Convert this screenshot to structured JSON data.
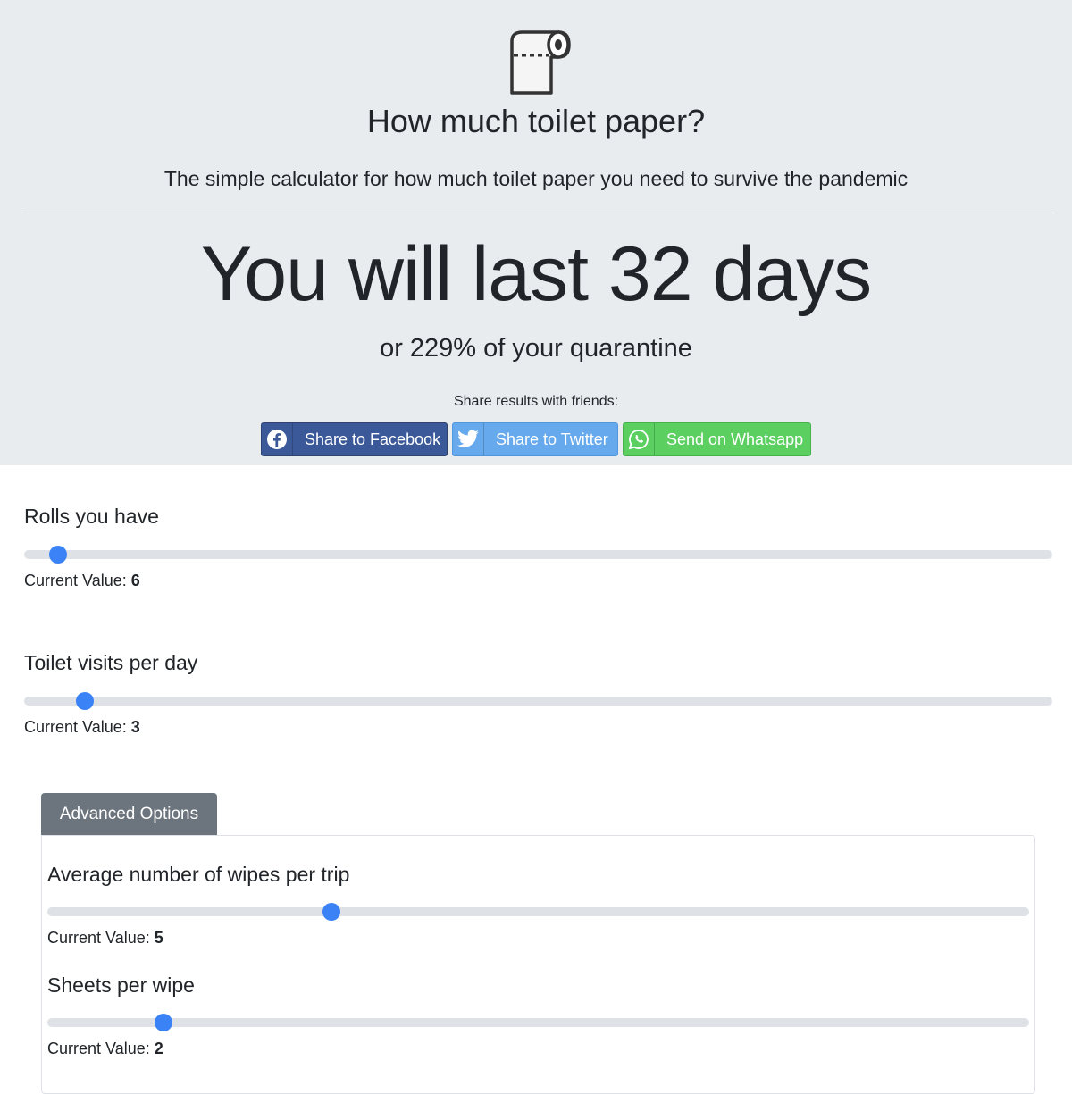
{
  "header": {
    "logo_icon": "toilet-paper-roll-icon",
    "title": "How much toilet paper?",
    "subtitle": "The simple calculator for how much toilet paper you need to survive the pandemic"
  },
  "result": {
    "prefix": "You will last ",
    "days": "32",
    "suffix": " days",
    "percent_prefix": "or ",
    "percent": "229%",
    "percent_suffix": " of your quarantine"
  },
  "share": {
    "label": "Share results with friends:",
    "facebook": {
      "label": "Share to Facebook",
      "icon": "facebook-icon",
      "color": "#3b5998"
    },
    "twitter": {
      "label": "Share to Twitter",
      "icon": "twitter-icon",
      "color": "#66a9ec"
    },
    "whatsapp": {
      "label": "Send on Whatsapp",
      "icon": "whatsapp-icon",
      "color": "#5ccf61"
    }
  },
  "sliders": {
    "rolls": {
      "label": "Rolls you have",
      "current_label": "Current Value: ",
      "value": "6",
      "fill_fraction": 0.033
    },
    "visits": {
      "label": "Toilet visits per day",
      "current_label": "Current Value: ",
      "value": "3",
      "fill_fraction": 0.059
    }
  },
  "advanced": {
    "button_label": "Advanced Options",
    "wipes": {
      "label": "Average number of wipes per trip",
      "current_label": "Current Value: ",
      "value": "5",
      "fill_fraction": 0.289
    },
    "sheets": {
      "label": "Sheets per wipe",
      "current_label": "Current Value: ",
      "value": "2",
      "fill_fraction": 0.118
    }
  },
  "colors": {
    "hero_bg": "#e9ecef",
    "slider_thumb": "#3b82f6",
    "slider_track": "#dee2e6",
    "advanced_button": "#6c757d"
  }
}
